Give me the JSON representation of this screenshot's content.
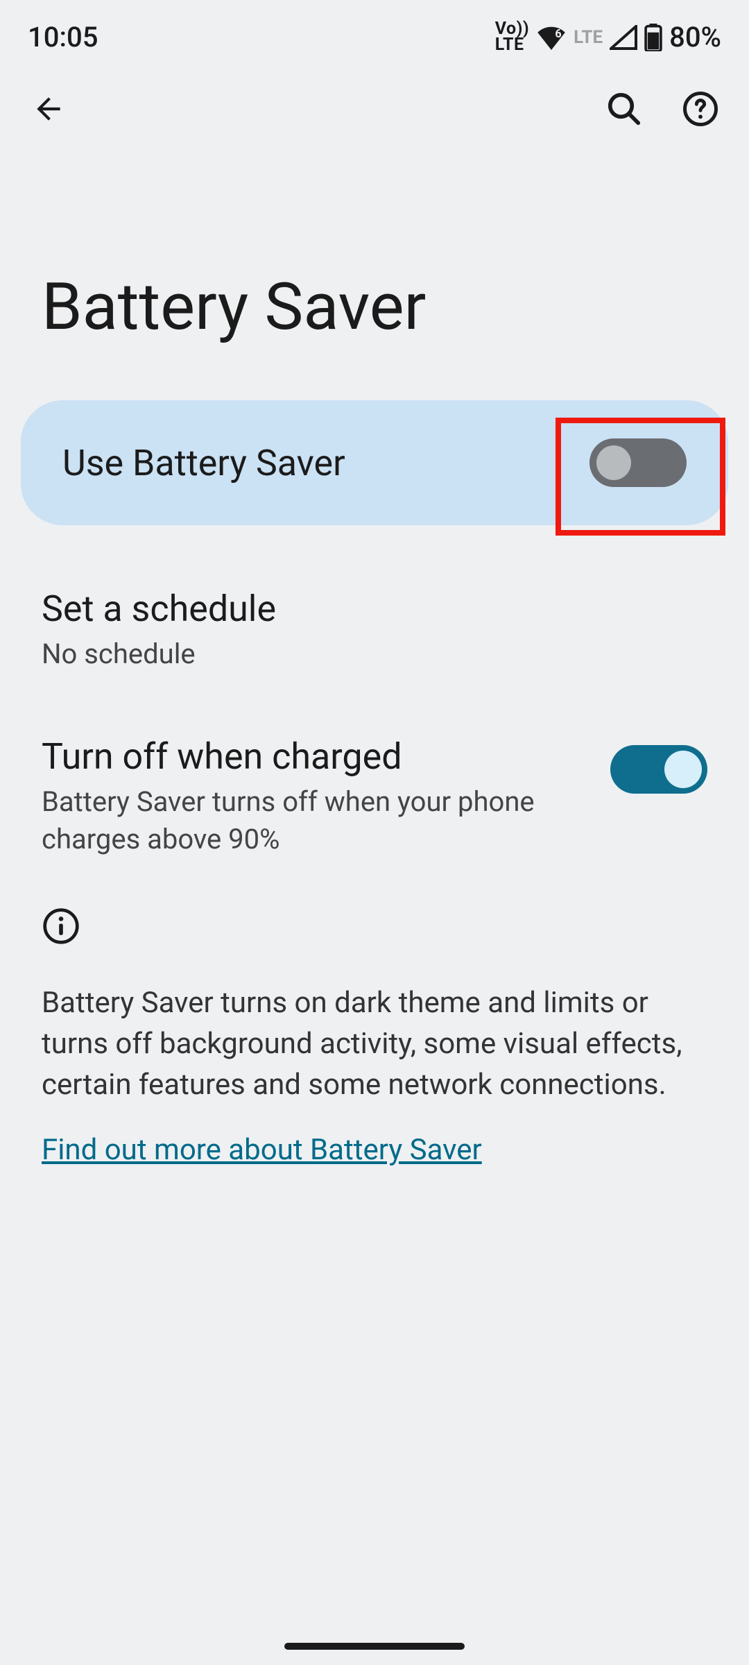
{
  "status": {
    "time": "10:05",
    "volte": "Vo\nLTE",
    "lte": "LTE",
    "battery_pct": "80%"
  },
  "page": {
    "title": "Battery Saver"
  },
  "use_saver": {
    "label": "Use Battery Saver",
    "enabled": false
  },
  "schedule": {
    "title": "Set a schedule",
    "subtitle": "No schedule"
  },
  "turn_off_charged": {
    "title": "Turn off when charged",
    "subtitle": "Battery Saver turns off when your phone charges above 90%",
    "enabled": true
  },
  "description": "Battery Saver turns on dark theme and limits or turns off background activity, some visual effects, certain features and some network connections.",
  "learn_more": "Find out more about Battery Saver"
}
